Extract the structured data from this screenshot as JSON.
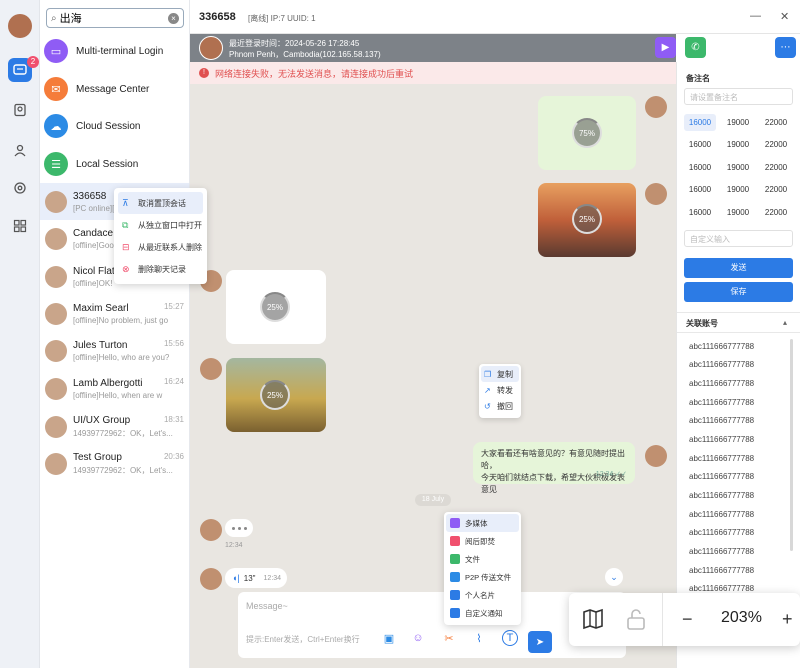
{
  "search": {
    "value": "出海"
  },
  "rail": {
    "badge": "2"
  },
  "features": [
    {
      "label": "Multi-terminal Login",
      "color": "#8f5cf5",
      "icon": "▭"
    },
    {
      "label": "Message Center",
      "color": "#f57c3a",
      "icon": "✉"
    },
    {
      "label": "Cloud Session",
      "color": "#2c8be5",
      "icon": "☁"
    },
    {
      "label": "Local Session",
      "color": "#3cb86b",
      "icon": "☰"
    }
  ],
  "contacts": [
    {
      "name": "336658",
      "msg": "[PC online][S",
      "time": ""
    },
    {
      "name": "Candace F",
      "msg": "[offline]Goo",
      "time": ""
    },
    {
      "name": "Nicol Flatt",
      "msg": "[offline]OK!",
      "time": ""
    },
    {
      "name": "Maxim Searl",
      "msg": "[offline]No problem, just go",
      "time": "15:27"
    },
    {
      "name": "Jules Turton",
      "msg": "[offline]Hello, who are you?",
      "time": "15:56"
    },
    {
      "name": "Lamb Albergotti",
      "msg": "[offline]Hello, when are w",
      "time": "16:24"
    },
    {
      "name": "UI/UX Group",
      "msg": "14939772962：OK，Let's...",
      "time": "18:31"
    },
    {
      "name": "Test Group",
      "msg": "14939772962：OK，Let's...",
      "time": "20:36"
    }
  ],
  "context_menu": [
    "取消置顶会话",
    "从独立窗口中打开",
    "从最近联系人删除",
    "删除聊天记录"
  ],
  "chat_header": {
    "name": "336658",
    "info": "[离线] IP:7 UUID: 1"
  },
  "session_bar": {
    "last_login": "最近登录时间：2024-05-26 17:28:45",
    "location": "Phnom Penh，Cambodia(102.165.58.137)"
  },
  "alert": "网络连接失败，无法发送消息，请连接成功后重试",
  "progress": {
    "p1": "75%",
    "p2": "25%",
    "p3": "25%",
    "p4": "25%"
  },
  "message_menu": [
    "复制",
    "转发",
    "撤回"
  ],
  "text_message": {
    "line1": "大家看看还有啥意见的？有意见随时提出哈，",
    "line2": "今天咱们就结点下载，希望大伙积极发表意见",
    "time": "12:34 ✓✓"
  },
  "date_pill": "18 July",
  "typing_time": "12:34",
  "voice": {
    "duration": "13\"",
    "time": "12:34"
  },
  "composer": {
    "placeholder": "Message~",
    "hint": "提示:Enter发送，Ctrl+Enter换行"
  },
  "attach_menu": [
    {
      "label": "多媒体",
      "color": "#8f5cf5"
    },
    {
      "label": "阅后即焚",
      "color": "#f0506e"
    },
    {
      "label": "文件",
      "color": "#3cb86b"
    },
    {
      "label": "P2P 传送文件",
      "color": "#2c8be5"
    },
    {
      "label": "个人名片",
      "color": "#2c7be5"
    },
    {
      "label": "自定义通知",
      "color": "#2c7be5"
    }
  ],
  "right_panel": {
    "remark_title": "备注名",
    "remark_placeholder": "请设置备注名",
    "amounts": [
      "16000",
      "19000",
      "22000",
      "16000",
      "19000",
      "22000",
      "16000",
      "19000",
      "22000",
      "16000",
      "19000",
      "22000",
      "16000",
      "19000",
      "22000"
    ],
    "custom_placeholder": "自定义输入",
    "send_label": "发送",
    "save_label": "保存",
    "accounts_title": "关联账号",
    "accounts": [
      "abc111666777788",
      "abc111666777788",
      "abc111666777788",
      "abc111666777788",
      "abc111666777788",
      "abc111666777788",
      "abc111666777788",
      "abc111666777788",
      "abc111666777788",
      "abc111666777788",
      "abc111666777788",
      "abc111666777788",
      "abc111666777788",
      "abc111666777788"
    ]
  },
  "zoom": {
    "value": "203%"
  }
}
